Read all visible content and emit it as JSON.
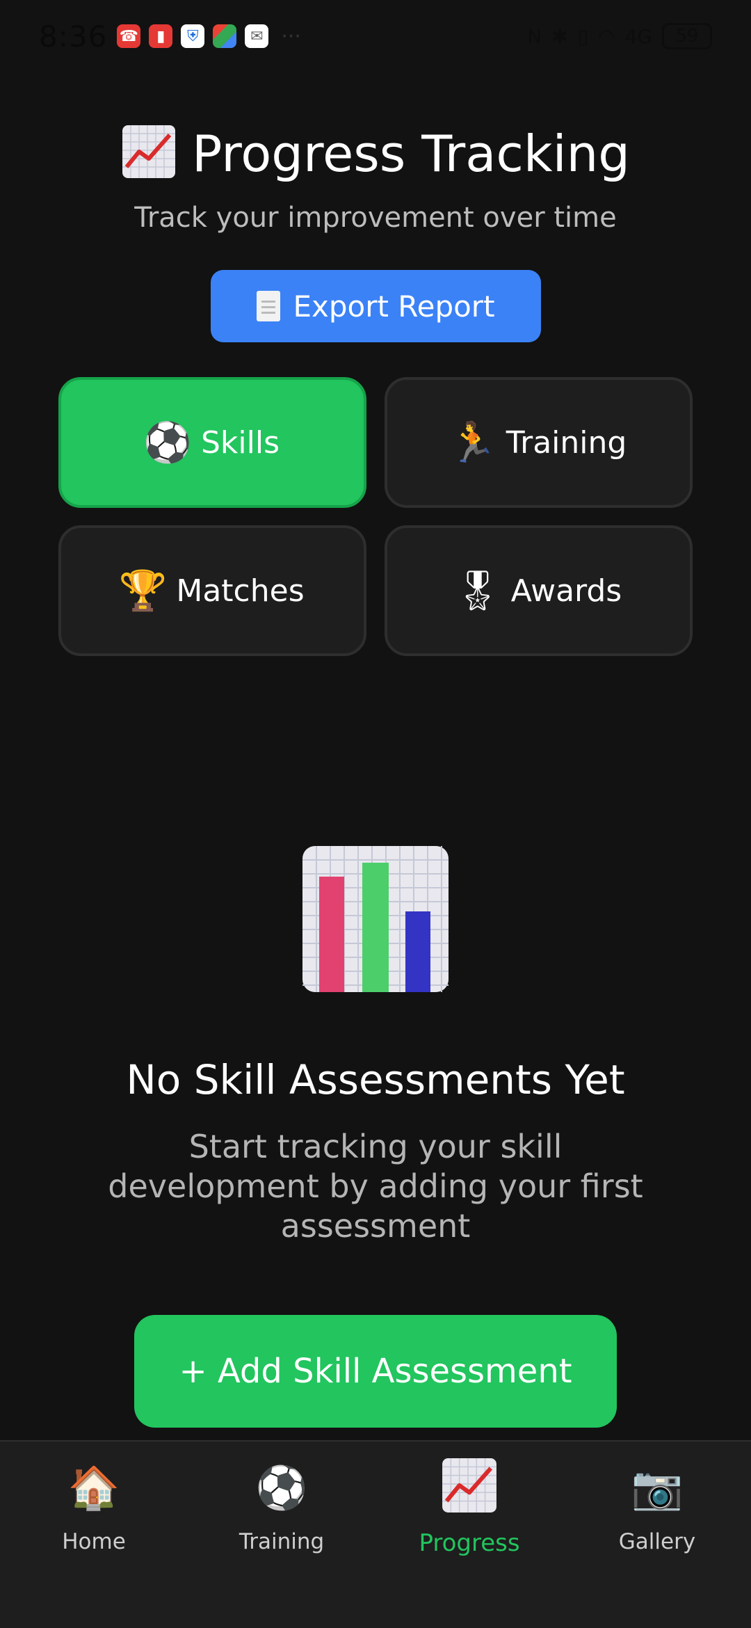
{
  "status_bar": {
    "time": "8:36",
    "more": "···",
    "battery": "59",
    "signal_text": "4G"
  },
  "header": {
    "title": "Progress Tracking",
    "subtitle": "Track your improvement over time"
  },
  "export_button": {
    "label": "Export Report"
  },
  "tabs": [
    {
      "label": "Skills",
      "emoji": "⚽",
      "active": true
    },
    {
      "label": "Training",
      "emoji": "🏃",
      "active": false
    },
    {
      "label": "Matches",
      "emoji": "🏆",
      "active": false
    },
    {
      "label": "Awards",
      "emoji": "🎖",
      "active": false
    }
  ],
  "empty_state": {
    "title": "No Skill Assessments Yet",
    "description": "Start tracking your skill development by adding your first assessment",
    "button_label": "+ Add Skill Assessment"
  },
  "bottom_nav": [
    {
      "label": "Home",
      "icon": "house-icon",
      "emoji": "🏠"
    },
    {
      "label": "Training",
      "icon": "soccer-ball-icon",
      "emoji": "⚽"
    },
    {
      "label": "Progress",
      "icon": "trend-chart-icon",
      "active": true
    },
    {
      "label": "Gallery",
      "icon": "camera-icon",
      "emoji": "📷"
    }
  ],
  "colors": {
    "background": "#121212",
    "accent_green": "#22c55e",
    "accent_blue": "#3b82f6",
    "card": "#1e1e1e"
  }
}
